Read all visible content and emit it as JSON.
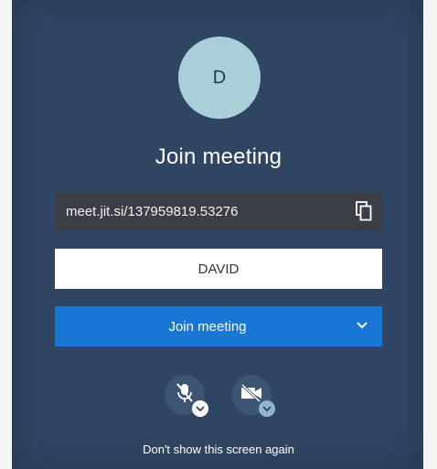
{
  "prejoin": {
    "avatar_initial": "D",
    "title": "Join meeting",
    "meeting_url": "meet.jit.si/137959819.53276",
    "name_value": "DAVID",
    "join_label": "Join meeting",
    "dont_show_label": "Don't show this screen again"
  },
  "icons": {
    "copy": "copy-icon",
    "dropdown": "chevron-down-icon",
    "mic": "microphone-muted-icon",
    "camera": "camera-off-icon"
  },
  "colors": {
    "background": "#2f4561",
    "avatar": "#a9cfd9",
    "url_bar": "#3b3f45",
    "join_button": "#1976d2"
  }
}
